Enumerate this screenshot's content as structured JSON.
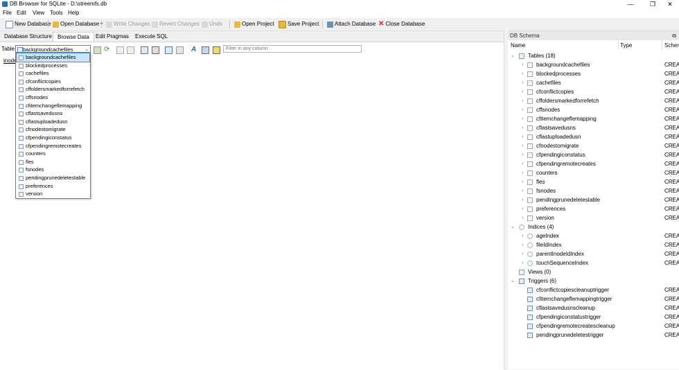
{
  "window": {
    "title": "DB Browser for SQLite - D:\\streemfs.db",
    "minimize": "—",
    "maximize": "❐",
    "close": "✕"
  },
  "menu": [
    "File",
    "Edit",
    "View",
    "Tools",
    "Help"
  ],
  "toolbar": {
    "new_database": "New Database",
    "open_database": "Open Database",
    "write_changes": "Write Changes",
    "revert_changes": "Revert Changes",
    "undo": "Undo",
    "open_project": "Open Project",
    "save_project": "Save Project",
    "attach_database": "Attach Database",
    "close_database": "Close Database"
  },
  "tabs": [
    "Database Structure",
    "Browse Data",
    "Edit Pragmas",
    "Execute SQL"
  ],
  "active_tab": "Browse Data",
  "browse": {
    "table_label": "Table:",
    "selected_table": "backgroundcachefiles",
    "filter_placeholder": "Filter in any column",
    "first_column": "inode"
  },
  "dropdown_items": [
    "backgroundcachefiles",
    "blockedprocesses",
    "cachefiles",
    "cfconflictcopies",
    "cffoldersmarkedforrefetch",
    "cffsnodes",
    "cfitemchangeflemapping",
    "cflastsavedusns",
    "cflastuploadedusn",
    "cfnodestomigrate",
    "cfpendingiconstatus",
    "cfpendingremotecreates",
    "counters",
    "fles",
    "fsnodes",
    "pendingprunedeletestable",
    "preferences",
    "version"
  ],
  "schema": {
    "title": "DB Schema",
    "float_icon": "⧉",
    "columns": [
      "Name",
      "Type",
      "Schema"
    ],
    "schema_value": "CREA",
    "tables_header": "Tables (18)",
    "tables": [
      "backgroundcachefiles",
      "blockedprocesses",
      "cachefiles",
      "cfconflictcopies",
      "cffoldersmarkedforrefetch",
      "cffsnodes",
      "cfitemchangeflemapping",
      "cflastsavedusns",
      "cflastuploadedusn",
      "cfnodestomigrate",
      "cfpendingiconstatus",
      "cfpendingremotecreates",
      "counters",
      "fles",
      "fsnodes",
      "pendingprunedeletestable",
      "preferences",
      "version"
    ],
    "indices_header": "Indices (4)",
    "indices": [
      "ageIndex",
      "fileIdIndex",
      "parentInodeIdIndex",
      "touchSequenceIndex"
    ],
    "views_header": "Views (0)",
    "triggers_header": "Triggers (6)",
    "triggers": [
      "cfconflictcopiescleanuptrigger",
      "cfitemchangeflemappingtrigger",
      "cflastsavedusnscleanup",
      "cfpendingiconstatustrigger",
      "cfpendingremotecreatescleanup",
      "pendingprunedeletestrigger"
    ]
  }
}
